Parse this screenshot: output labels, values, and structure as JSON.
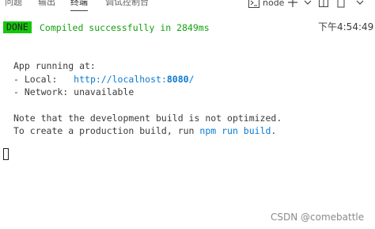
{
  "tabs": [
    {
      "label": "问题",
      "active": false
    },
    {
      "label": "输出",
      "active": false
    },
    {
      "label": "终端",
      "active": true
    },
    {
      "label": "调试控制台",
      "active": false
    }
  ],
  "toolbar": {
    "terminal_name": "node",
    "icons": [
      "terminal-icon",
      "plus-icon",
      "chevron-down-icon",
      "split-icon",
      "trash-icon",
      "more-icon"
    ]
  },
  "terminal": {
    "status_badge": "DONE",
    "compiled_message": "Compiled successfully in 2849ms",
    "timestamp": "下午4:54:49",
    "app_running": "App running at:",
    "local_label": "- Local:   ",
    "local_url": "http://localhost:",
    "local_port": "8080",
    "local_url_tail": "/",
    "network_line": "- Network: unavailable",
    "note_line": "Note that the development build is not optimized.",
    "prod_prefix": "To create a production build, run ",
    "prod_command": "npm run build",
    "prod_suffix": "."
  },
  "watermark": "CSDN @comebattle",
  "colors": {
    "badge_bg": "#16c60c",
    "success_text": "#13a10e",
    "link": "#0b7ad1"
  }
}
